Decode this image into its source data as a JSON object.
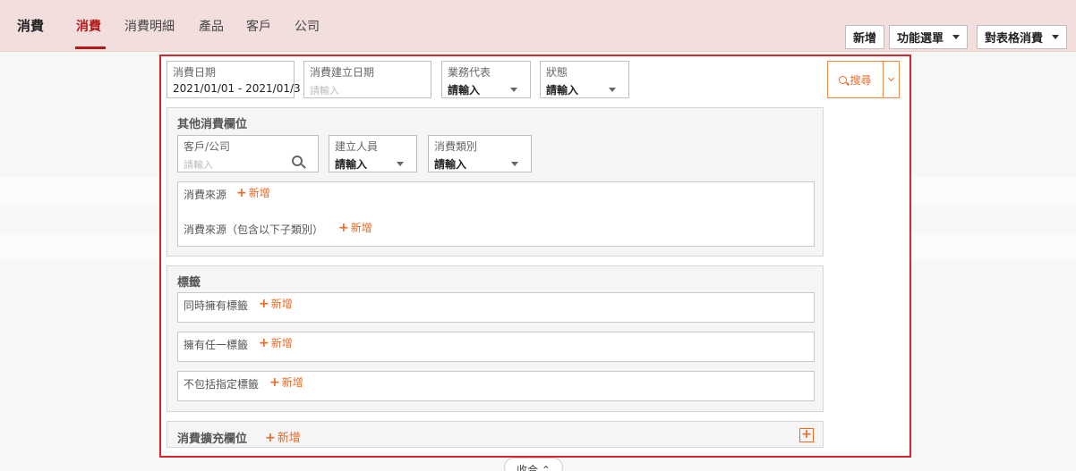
{
  "header": {
    "app_title": "消費",
    "tabs": [
      {
        "label": "消費",
        "active": true
      },
      {
        "label": "消費明細"
      },
      {
        "label": "產品"
      },
      {
        "label": "客戶"
      },
      {
        "label": "公司"
      }
    ],
    "buttons": {
      "new": "新增",
      "function_menu": "功能選單",
      "batch_consume": "對表格消費"
    }
  },
  "filters": {
    "consume_date": {
      "label": "消費日期",
      "value": "2021/01/01 - 2021/01/3"
    },
    "created_date": {
      "label": "消費建立日期",
      "placeholder": "請輸入"
    },
    "sales_rep": {
      "label": "業務代表",
      "value": "請輸入"
    },
    "status": {
      "label": "狀態",
      "value": "請輸入"
    },
    "search_label": "搜尋"
  },
  "other_fields": {
    "title": "其他消費欄位",
    "customer": {
      "label": "客戶/公司",
      "placeholder": "請輸入"
    },
    "creator": {
      "label": "建立人員",
      "value": "請輸入"
    },
    "category": {
      "label": "消費類別",
      "value": "請輸入"
    },
    "source_label": "消費來源",
    "source_sub_label": "消費來源（包含以下子類別）",
    "add": "新增"
  },
  "tags": {
    "title": "標籤",
    "has_all": "同時擁有標籤",
    "has_any": "擁有任一標籤",
    "exclude": "不包括指定標籤",
    "add": "新增"
  },
  "extension": {
    "title": "消費擴充欄位",
    "add": "新增"
  },
  "collapse_label": "收合 ⌃"
}
